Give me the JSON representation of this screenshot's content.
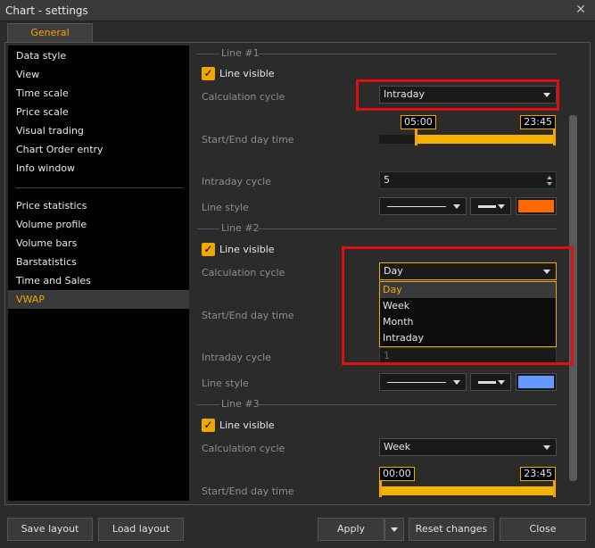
{
  "window": {
    "title": "Chart - settings",
    "close_glyph": "✕"
  },
  "tabs": [
    {
      "label": "General"
    }
  ],
  "nav": {
    "items": [
      {
        "label": "Data style"
      },
      {
        "label": "View"
      },
      {
        "label": "Time scale"
      },
      {
        "label": "Price scale"
      },
      {
        "label": "Visual trading"
      },
      {
        "label": "Chart Order entry"
      },
      {
        "label": "Info window"
      },
      {
        "label": "Price statistics"
      },
      {
        "label": "Volume profile"
      },
      {
        "label": "Volume bars"
      },
      {
        "label": "Barstatistics"
      },
      {
        "label": "Time and Sales"
      },
      {
        "label": "VWAP"
      }
    ],
    "active": "VWAP"
  },
  "lines": [
    {
      "heading": "Line #1",
      "visible_label": "Line visible",
      "calc_label": "Calculation cycle",
      "calc_value": "Intraday",
      "startend_label": "Start/End day time",
      "start_time": "05:00",
      "end_time": "23:45",
      "range_start_fraction": 0.208,
      "range_end_fraction": 0.99,
      "intraday_label": "Intraday cycle",
      "intraday_value": "5",
      "style_label": "Line style",
      "color": "#ff6a00"
    },
    {
      "heading": "Line #2",
      "visible_label": "Line visible",
      "calc_label": "Calculation cycle",
      "calc_value": "Day",
      "dropdown_options": [
        "Day",
        "Week",
        "Month",
        "Intraday"
      ],
      "startend_label": "Start/End day time",
      "intraday_label": "Intraday cycle",
      "intraday_value": "1",
      "style_label": "Line style",
      "color": "#6699ff"
    },
    {
      "heading": "Line #3",
      "visible_label": "Line visible",
      "calc_label": "Calculation cycle",
      "calc_value": "Week",
      "startend_label": "Start/End day time",
      "start_time": "00:00",
      "end_time": "23:45",
      "range_start_fraction": 0.0,
      "range_end_fraction": 0.99
    }
  ],
  "buttons": {
    "save_layout": "Save layout",
    "load_layout": "Load layout",
    "apply": "Apply",
    "reset": "Reset changes",
    "close": "Close"
  },
  "colors": {
    "accent": "#f0a800",
    "highlight": "#e01010"
  }
}
